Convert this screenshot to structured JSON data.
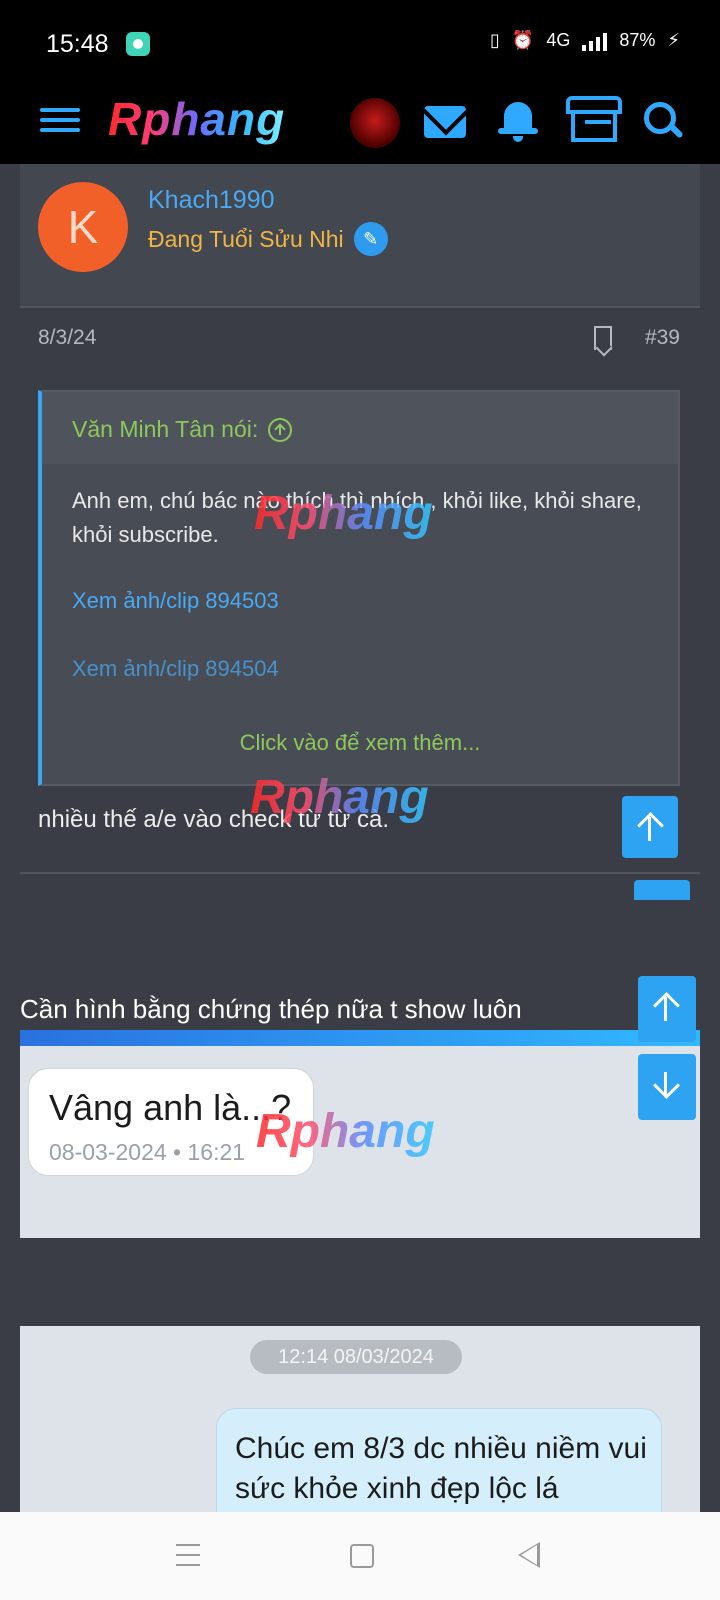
{
  "status_bar": {
    "time": "15:48",
    "battery": "87%",
    "network": "4G"
  },
  "top_nav": {
    "logo_text": "Rphang"
  },
  "post": {
    "author": "Khach1990",
    "author_title": "Đang Tuổi Sửu Nhi",
    "avatar_letter": "K",
    "date": "8/3/24",
    "number": "#39",
    "quote": {
      "author": "Văn Minh Tân nói:",
      "text": "Anh em, chú bác nào thích thì nhích , khỏi like, khỏi share, khỏi subscribe.",
      "link1": "Xem ảnh/clip 894503",
      "link2": "Xem ảnh/clip 894504",
      "more": "Click vào để xem thêm..."
    },
    "body_text": "nhiều thế a/e vào check từ từ cà."
  },
  "next_post": {
    "text": "Cần hình bằng chứng thép nữa t show luôn",
    "image1": {
      "message": "Vâng anh là...?",
      "timestamp": "08-03-2024 • 16:21"
    },
    "image2": {
      "date_pill": "12:14 08/03/2024",
      "message": "Chúc em 8/3 dc nhiều niềm vui sức khỏe xinh đẹp lộc lá"
    }
  },
  "watermark": "Rphang",
  "colors": {
    "accent": "#2fa8ff",
    "background": "#3a3d45",
    "username": "#49a9f2",
    "user_title": "#f0b545",
    "quote_author": "#8ec85a",
    "avatar": "#f2602a"
  }
}
